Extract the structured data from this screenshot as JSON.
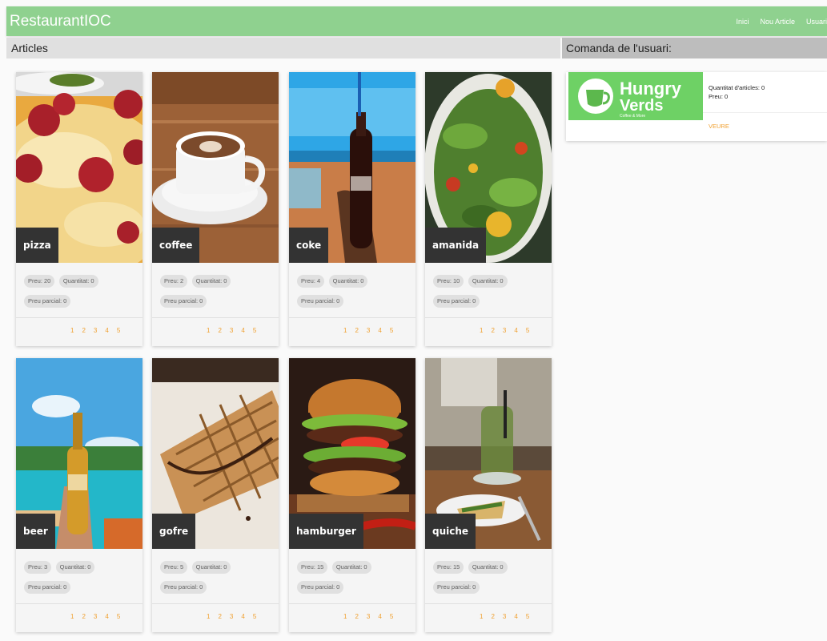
{
  "app": {
    "title": "RestaurantIOC"
  },
  "nav": {
    "items": [
      "Inici",
      "Nou Article",
      "Usuari"
    ]
  },
  "sections": {
    "articles": "Articles",
    "order": "Comanda de l'usuari:"
  },
  "labels": {
    "preu": "Preu:",
    "quantitat": "Quantitat:",
    "parcial": "Preu parcial:"
  },
  "articles": [
    {
      "name": "pizza",
      "price": "Preu: 20",
      "qty": "Quantitat: 0",
      "partial": "Preu parcial: 0"
    },
    {
      "name": "coffee",
      "price": "Preu: 2",
      "qty": "Quantitat: 0",
      "partial": "Preu parcial: 0"
    },
    {
      "name": "coke",
      "price": "Preu: 4",
      "qty": "Quantitat: 0",
      "partial": "Preu parcial: 0"
    },
    {
      "name": "amanida",
      "price": "Preu: 10",
      "qty": "Quantitat: 0",
      "partial": "Preu parcial: 0"
    },
    {
      "name": "beer",
      "price": "Preu: 3",
      "qty": "Quantitat: 0",
      "partial": "Preu parcial: 0"
    },
    {
      "name": "gofre",
      "price": "Preu: 5",
      "qty": "Quantitat: 0",
      "partial": "Preu parcial: 0"
    },
    {
      "name": "hamburger",
      "price": "Preu: 15",
      "qty": "Quantitat: 0",
      "partial": "Preu parcial: 0"
    },
    {
      "name": "quiche",
      "price": "Preu: 15",
      "qty": "Quantitat: 0",
      "partial": "Preu parcial: 0"
    }
  ],
  "pagination": [
    "1",
    "2",
    "3",
    "4",
    "5"
  ],
  "order": {
    "logo_text_1": "Hungry",
    "logo_text_2": "Verds",
    "logo_tagline": "Coffee & More",
    "items_count": "Quantitat d'articles: 0",
    "price": "Preu: 0",
    "action": "VEURE"
  },
  "colors": {
    "appbar": "#8fd18f",
    "accent": "#f0a030",
    "logo_bg": "#6ed165"
  }
}
